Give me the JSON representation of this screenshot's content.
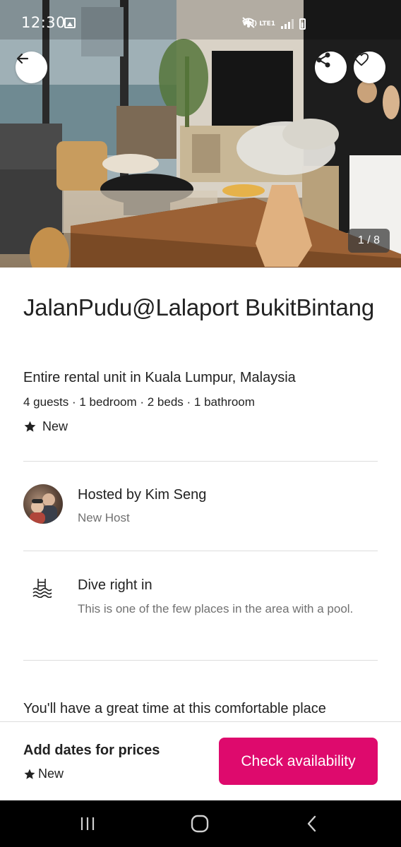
{
  "status_bar": {
    "time": "12:30",
    "network_label": "Vo)) LTE1"
  },
  "hero": {
    "photo_counter": "1 / 8",
    "buttons": {
      "back_icon": "arrow-left-icon",
      "share_icon": "share-icon",
      "save_icon": "heart-icon"
    }
  },
  "listing": {
    "title": "JalanPudu@Lalaport BukitBintang",
    "subtitle": "Entire rental unit in Kuala Lumpur, Malaysia",
    "details": "4 guests · 1 bedroom · 2 beds · 1 bathroom",
    "rating": "New"
  },
  "host": {
    "name": "Hosted by Kim Seng",
    "status": "New Host"
  },
  "highlight": {
    "icon": "pool-icon",
    "title": "Dive right in",
    "description": "This is one of the few places in the area with a pool."
  },
  "description": "You'll have a great time at this comfortable place",
  "footer": {
    "price_prompt": "Add dates for prices",
    "rating": "New",
    "cta_label": "Check availability",
    "cta_color": "#de0a6d"
  },
  "nav_bar": {
    "recent_icon": "recent-apps-icon",
    "home_icon": "home-icon",
    "back_icon": "nav-back-icon"
  }
}
